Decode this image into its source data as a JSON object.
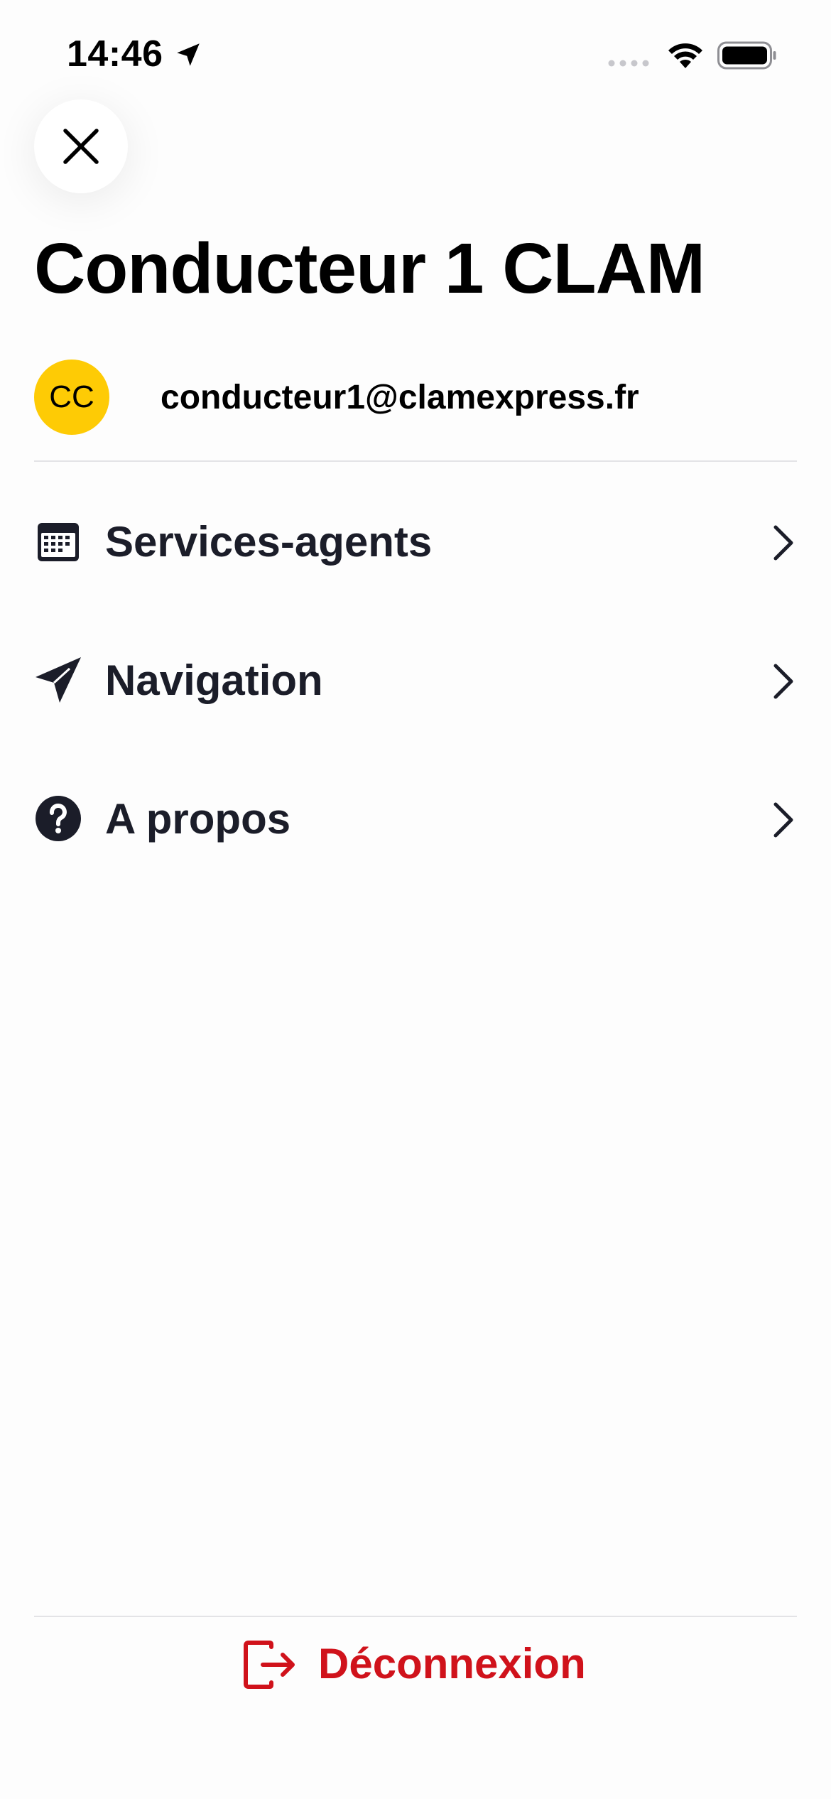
{
  "status_bar": {
    "time": "14:46",
    "location_icon": "location-arrow-icon",
    "signal_icon": "cellular-signal-icon",
    "wifi_icon": "wifi-icon",
    "battery_icon": "battery-icon"
  },
  "header": {
    "close_icon": "close-icon",
    "title": "Conducteur 1 CLAM"
  },
  "user": {
    "initials": "CC",
    "email": "conducteur1@clamexpress.fr",
    "avatar_color": "#fecb05"
  },
  "menu": {
    "items": [
      {
        "label": "Services-agents",
        "icon": "calendar-icon"
      },
      {
        "label": "Navigation",
        "icon": "paper-plane-icon"
      },
      {
        "label": "A propos",
        "icon": "question-circle-icon"
      }
    ],
    "chevron_icon": "chevron-right-icon"
  },
  "footer": {
    "logout_label": "Déconnexion",
    "logout_icon": "logout-icon",
    "logout_color": "#d0121b"
  },
  "colors": {
    "text_primary": "#1b1d29",
    "divider": "#e3e3e6",
    "accent_yellow": "#fecb05",
    "danger_red": "#d0121b"
  }
}
